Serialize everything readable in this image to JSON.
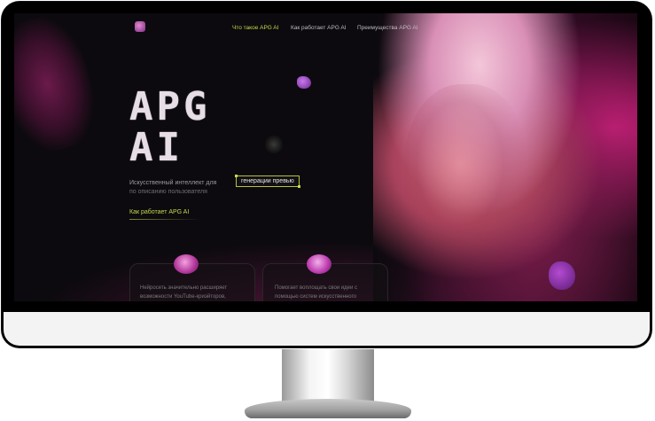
{
  "nav": {
    "links": [
      {
        "label": "Что такое APG AI"
      },
      {
        "label": "Как работает APG AI"
      },
      {
        "label": "Преимущества APG AI"
      }
    ]
  },
  "hero": {
    "title_line1": "APG",
    "title_line2": "AI",
    "subtitle_part1": "Искусственный интеллект для",
    "subtitle_highlight": "генерации превью",
    "subtitle_part2": "по описанию пользователя",
    "cta": "Как работает APG AI"
  },
  "cards": [
    {
      "line1": "Нейросеть значительно расширяет",
      "line2": "возможности YouTube-криэйторов,"
    },
    {
      "line1": "Помогает воплощать свои идеи с",
      "line2": "помощью систем искусственного"
    }
  ],
  "colors": {
    "accent": "#c9d94a",
    "background": "#0c0a0e",
    "brand_pink": "#c81f7a"
  }
}
